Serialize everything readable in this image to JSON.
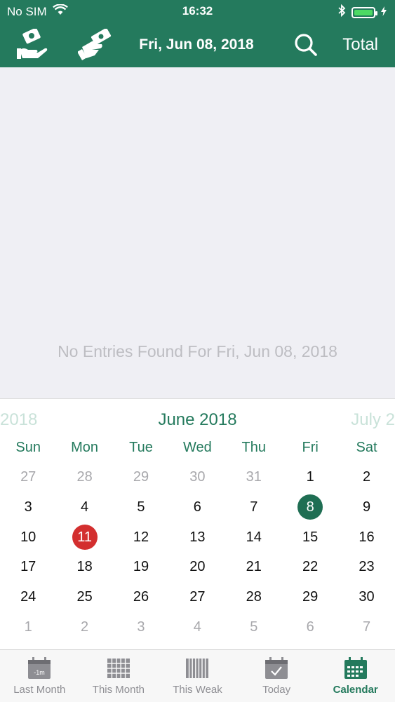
{
  "status_bar": {
    "carrier": "No SIM",
    "time": "16:32"
  },
  "nav": {
    "title": "Fri, Jun 08, 2018",
    "total_label": "Total"
  },
  "content": {
    "empty_message": "No Entries Found For Fri, Jun 08, 2018"
  },
  "calendar": {
    "prev_month": "2018",
    "current_month": "June 2018",
    "next_month": "July 2",
    "weekdays": [
      "Sun",
      "Mon",
      "Tue",
      "Wed",
      "Thu",
      "Fri",
      "Sat"
    ],
    "weeks": [
      [
        "27",
        "28",
        "29",
        "30",
        "31",
        "1",
        "2"
      ],
      [
        "3",
        "4",
        "5",
        "6",
        "7",
        "8",
        "9"
      ],
      [
        "10",
        "11",
        "12",
        "13",
        "14",
        "15",
        "16"
      ],
      [
        "17",
        "18",
        "19",
        "20",
        "21",
        "22",
        "23"
      ],
      [
        "24",
        "25",
        "26",
        "27",
        "28",
        "29",
        "30"
      ],
      [
        "1",
        "2",
        "3",
        "4",
        "5",
        "6",
        "7"
      ]
    ],
    "today_day": "11",
    "selected_day": "8"
  },
  "tabs": [
    {
      "label": "Last Month",
      "icon": "calendar-minus-icon",
      "badge": "-1m"
    },
    {
      "label": "This Month",
      "icon": "calendar-grid-icon"
    },
    {
      "label": "This Weak",
      "icon": "calendar-week-icon"
    },
    {
      "label": "Today",
      "icon": "calendar-check-icon"
    },
    {
      "label": "Calendar",
      "icon": "calendar-icon"
    }
  ],
  "colors": {
    "primary": "#247a5d",
    "today": "#d32f2f",
    "selected": "#1f6e53"
  }
}
